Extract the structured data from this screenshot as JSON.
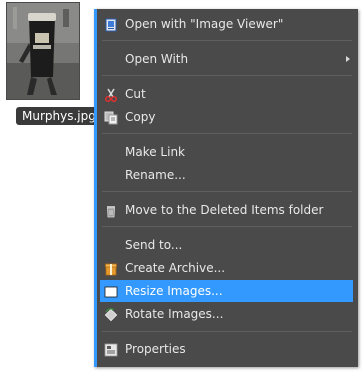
{
  "file": {
    "name": "Murphys.jpg",
    "thumbnail_icon": "image-thumbnail"
  },
  "menu": {
    "accent_color": "#3399ff",
    "items": [
      {
        "key": "open-with-image-viewer",
        "label": "Open with \"Image Viewer\"",
        "icon": "image-viewer-icon"
      },
      {
        "key": "open-with",
        "label": "Open With",
        "icon": "",
        "submenu": true
      },
      {
        "key": "cut",
        "label": "Cut",
        "icon": "scissors-icon"
      },
      {
        "key": "copy",
        "label": "Copy",
        "icon": "copy-icon"
      },
      {
        "key": "make-link",
        "label": "Make Link",
        "icon": ""
      },
      {
        "key": "rename",
        "label": "Rename...",
        "icon": ""
      },
      {
        "key": "move-to-trash",
        "label": "Move to the Deleted Items folder",
        "icon": "trash-icon"
      },
      {
        "key": "send-to",
        "label": "Send to...",
        "icon": ""
      },
      {
        "key": "create-archive",
        "label": "Create Archive...",
        "icon": "archive-icon"
      },
      {
        "key": "resize-images",
        "label": "Resize Images...",
        "icon": "resize-icon",
        "selected": true
      },
      {
        "key": "rotate-images",
        "label": "Rotate Images...",
        "icon": "rotate-icon"
      },
      {
        "key": "properties",
        "label": "Properties",
        "icon": "properties-icon"
      }
    ]
  }
}
